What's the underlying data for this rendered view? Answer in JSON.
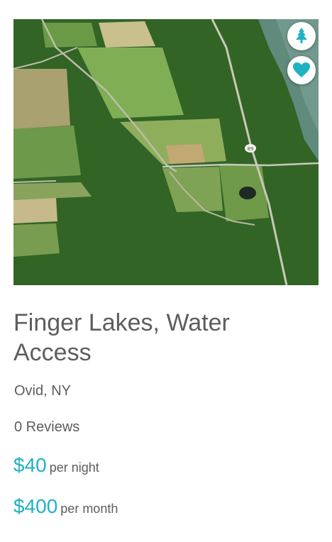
{
  "listing": {
    "title": "Finger Lakes, Water Access",
    "location": "Ovid, NY",
    "reviews": "0 Reviews",
    "prices": [
      {
        "amount": "$40",
        "unit": "per night"
      },
      {
        "amount": "$400",
        "unit": "per month"
      }
    ],
    "photo_road_sign": "89"
  },
  "icons": {
    "tree": "tree-icon",
    "heart": "heart-icon"
  },
  "colors": {
    "accent": "#1fb1c4",
    "text": "#5d5d5d"
  }
}
